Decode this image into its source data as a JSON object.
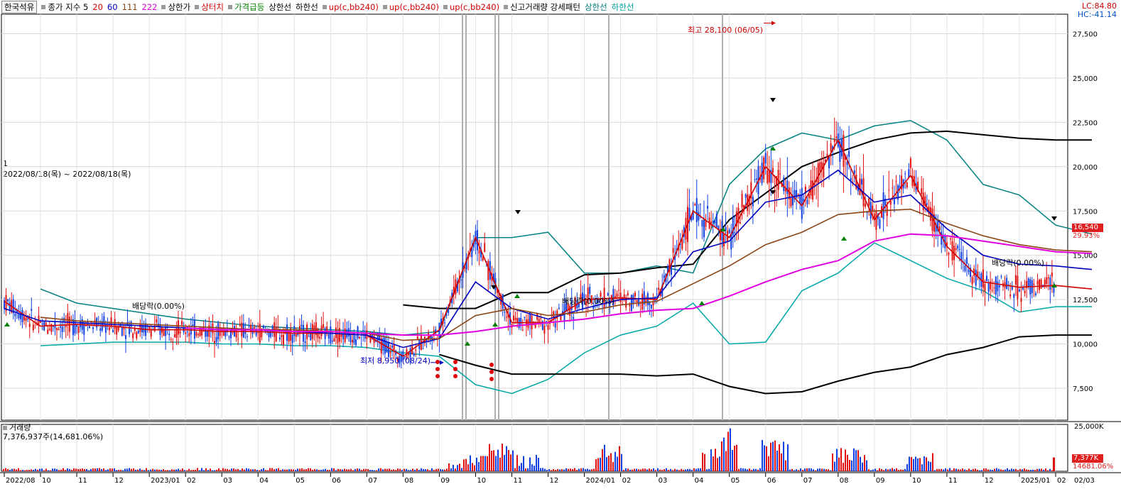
{
  "legend": {
    "stock": "한국석유",
    "price_label": "종가 지수 5",
    "ma_20": "20",
    "ma_60": "60",
    "ma_111": "111",
    "ma_222": "222",
    "items": [
      "상한가",
      "상터치",
      "가격급등",
      "상한선",
      "하한선",
      "up(c,bb240)",
      "up(c,bb240)",
      "up(c,bb240)",
      "신고거래량 강세패턴",
      "상한선",
      "하한선"
    ],
    "colors": {
      "ma_20": "#d00000",
      "ma_60": "#0000c0",
      "ma_111": "#8b4513",
      "ma_222": "#e000e0",
      "up": "#d00000",
      "green": "#008000",
      "black": "#000000",
      "teal": "#008080"
    }
  },
  "info": {
    "line1": "1",
    "line2": "2022/08/18(목) ~ 2022/08/18(목)"
  },
  "corner": {
    "lc": "LC:84.80",
    "hc": "HC:-41.14"
  },
  "price_badge": {
    "value": "16,540",
    "pct": "29.93%"
  },
  "annotations": {
    "high": "최고 28,100 (06/05)",
    "low": "최저 8,950 (08/24)",
    "dividend": "배당락(0.00%)"
  },
  "volume": {
    "title": "거래량",
    "value_text": "7,376,937주(14,681.06%)",
    "badge_value": "7,377K",
    "badge_pct": "14681.06%",
    "axis_top": "25,000K"
  },
  "chart_data": {
    "type": "candlestick",
    "y_axis_ticks": [
      7500,
      10000,
      12500,
      15000,
      17500,
      20000,
      22500,
      25000,
      27500
    ],
    "y_axis_labels": [
      "7,500",
      "10,000",
      "12,500",
      "15,000",
      "17,500",
      "20,000",
      "22,500",
      "25,000",
      "27,500"
    ],
    "ylim": [
      5700,
      28600
    ],
    "x_ticks": [
      "2022/08",
      "10",
      "11",
      "12",
      "2023/01",
      "02",
      "03",
      "04",
      "05",
      "06",
      "07",
      "08",
      "09",
      "10",
      "11",
      "12",
      "2024/01",
      "02",
      "03",
      "04",
      "05",
      "06",
      "07",
      "08",
      "09",
      "10",
      "11",
      "12",
      "2025/01",
      "02",
      "02/03"
    ],
    "series": [
      {
        "name": "20",
        "values": [
          12400,
          11000,
          11100,
          11000,
          10800,
          10800,
          10700,
          10700,
          10600,
          10600,
          10500,
          9300,
          10800,
          16000,
          11200,
          11200,
          12500,
          12600,
          12500,
          17500,
          16000,
          20000,
          17800,
          21500,
          17000,
          19500,
          15500,
          13500,
          13200,
          13300,
          13100
        ]
      },
      {
        "name": "60",
        "values": [
          12000,
          11300,
          11200,
          11100,
          11000,
          10900,
          10800,
          10800,
          10700,
          10600,
          10500,
          9800,
          10300,
          13500,
          12000,
          11400,
          12000,
          12500,
          12600,
          15200,
          15800,
          18000,
          18400,
          19800,
          18000,
          18400,
          16500,
          15000,
          14500,
          14400,
          14200
        ]
      },
      {
        "name": "111",
        "values": [
          null,
          11500,
          11300,
          11200,
          11100,
          11000,
          10900,
          10800,
          10800,
          10700,
          10600,
          10200,
          10300,
          11600,
          12000,
          11600,
          11800,
          12200,
          12400,
          13400,
          14400,
          15600,
          16300,
          17300,
          17500,
          17600,
          16800,
          16100,
          15600,
          15300,
          15200
        ]
      },
      {
        "name": "222",
        "values": [
          null,
          null,
          null,
          null,
          null,
          10900,
          10800,
          10800,
          10700,
          10700,
          10600,
          10500,
          10500,
          10700,
          11000,
          11200,
          11400,
          11700,
          11900,
          12000,
          12700,
          13500,
          14200,
          14700,
          15800,
          16200,
          16100,
          15800,
          15500,
          15200,
          15100
        ]
      }
    ],
    "bollinger_240": {
      "upper": [
        null,
        13100,
        12300,
        12000,
        11700,
        11400,
        11200,
        11000,
        10900,
        10800,
        10700,
        10500,
        10700,
        16000,
        16000,
        16300,
        14000,
        14000,
        14400,
        14000,
        19000,
        21000,
        21900,
        21500,
        22300,
        22600,
        21500,
        19000,
        18400,
        16700,
        16200
      ],
      "middle": [
        null,
        null,
        null,
        null,
        null,
        null,
        null,
        null,
        null,
        null,
        null,
        12200,
        12000,
        12000,
        12900,
        12900,
        13900,
        14000,
        14300,
        14500,
        17000,
        18500,
        20000,
        20800,
        21500,
        21900,
        22000,
        21800,
        21600,
        21500,
        21500
      ],
      "lower": [
        null,
        9900,
        10000,
        10100,
        10100,
        10100,
        10000,
        10000,
        9900,
        9900,
        9800,
        9500,
        9300,
        7700,
        7200,
        8000,
        9500,
        10500,
        11000,
        12300,
        10000,
        10100,
        13000,
        14000,
        15700,
        14700,
        13700,
        13000,
        11800,
        12100,
        12100
      ],
      "floor": [
        null,
        null,
        null,
        null,
        null,
        null,
        null,
        null,
        null,
        null,
        null,
        null,
        9400,
        8800,
        8300,
        8300,
        8300,
        8300,
        8200,
        8300,
        7600,
        7200,
        7300,
        7900,
        8400,
        8700,
        9400,
        9800,
        10400,
        10500,
        10500
      ]
    },
    "last_close": 16540,
    "period_high": 28100,
    "period_low": 8950,
    "volume": {
      "unit": "K",
      "ylim": [
        0,
        25000
      ],
      "last_volume": 7377
    }
  }
}
